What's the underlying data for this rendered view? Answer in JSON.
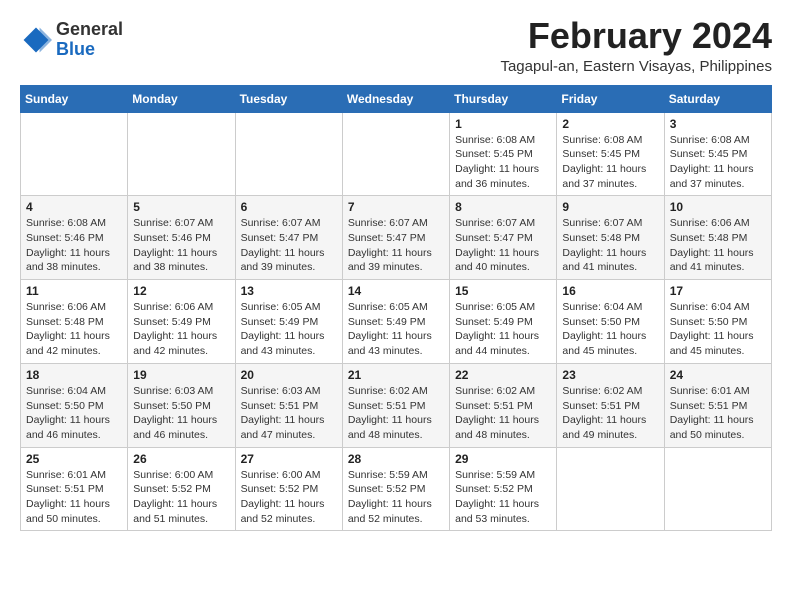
{
  "header": {
    "logo_general": "General",
    "logo_blue": "Blue",
    "month_year": "February 2024",
    "location": "Tagapul-an, Eastern Visayas, Philippines"
  },
  "weekdays": [
    "Sunday",
    "Monday",
    "Tuesday",
    "Wednesday",
    "Thursday",
    "Friday",
    "Saturday"
  ],
  "weeks": [
    [
      {
        "day": "",
        "sunrise": "",
        "sunset": "",
        "daylight": ""
      },
      {
        "day": "",
        "sunrise": "",
        "sunset": "",
        "daylight": ""
      },
      {
        "day": "",
        "sunrise": "",
        "sunset": "",
        "daylight": ""
      },
      {
        "day": "",
        "sunrise": "",
        "sunset": "",
        "daylight": ""
      },
      {
        "day": "1",
        "sunrise": "Sunrise: 6:08 AM",
        "sunset": "Sunset: 5:45 PM",
        "daylight": "Daylight: 11 hours and 36 minutes."
      },
      {
        "day": "2",
        "sunrise": "Sunrise: 6:08 AM",
        "sunset": "Sunset: 5:45 PM",
        "daylight": "Daylight: 11 hours and 37 minutes."
      },
      {
        "day": "3",
        "sunrise": "Sunrise: 6:08 AM",
        "sunset": "Sunset: 5:45 PM",
        "daylight": "Daylight: 11 hours and 37 minutes."
      }
    ],
    [
      {
        "day": "4",
        "sunrise": "Sunrise: 6:08 AM",
        "sunset": "Sunset: 5:46 PM",
        "daylight": "Daylight: 11 hours and 38 minutes."
      },
      {
        "day": "5",
        "sunrise": "Sunrise: 6:07 AM",
        "sunset": "Sunset: 5:46 PM",
        "daylight": "Daylight: 11 hours and 38 minutes."
      },
      {
        "day": "6",
        "sunrise": "Sunrise: 6:07 AM",
        "sunset": "Sunset: 5:47 PM",
        "daylight": "Daylight: 11 hours and 39 minutes."
      },
      {
        "day": "7",
        "sunrise": "Sunrise: 6:07 AM",
        "sunset": "Sunset: 5:47 PM",
        "daylight": "Daylight: 11 hours and 39 minutes."
      },
      {
        "day": "8",
        "sunrise": "Sunrise: 6:07 AM",
        "sunset": "Sunset: 5:47 PM",
        "daylight": "Daylight: 11 hours and 40 minutes."
      },
      {
        "day": "9",
        "sunrise": "Sunrise: 6:07 AM",
        "sunset": "Sunset: 5:48 PM",
        "daylight": "Daylight: 11 hours and 41 minutes."
      },
      {
        "day": "10",
        "sunrise": "Sunrise: 6:06 AM",
        "sunset": "Sunset: 5:48 PM",
        "daylight": "Daylight: 11 hours and 41 minutes."
      }
    ],
    [
      {
        "day": "11",
        "sunrise": "Sunrise: 6:06 AM",
        "sunset": "Sunset: 5:48 PM",
        "daylight": "Daylight: 11 hours and 42 minutes."
      },
      {
        "day": "12",
        "sunrise": "Sunrise: 6:06 AM",
        "sunset": "Sunset: 5:49 PM",
        "daylight": "Daylight: 11 hours and 42 minutes."
      },
      {
        "day": "13",
        "sunrise": "Sunrise: 6:05 AM",
        "sunset": "Sunset: 5:49 PM",
        "daylight": "Daylight: 11 hours and 43 minutes."
      },
      {
        "day": "14",
        "sunrise": "Sunrise: 6:05 AM",
        "sunset": "Sunset: 5:49 PM",
        "daylight": "Daylight: 11 hours and 43 minutes."
      },
      {
        "day": "15",
        "sunrise": "Sunrise: 6:05 AM",
        "sunset": "Sunset: 5:49 PM",
        "daylight": "Daylight: 11 hours and 44 minutes."
      },
      {
        "day": "16",
        "sunrise": "Sunrise: 6:04 AM",
        "sunset": "Sunset: 5:50 PM",
        "daylight": "Daylight: 11 hours and 45 minutes."
      },
      {
        "day": "17",
        "sunrise": "Sunrise: 6:04 AM",
        "sunset": "Sunset: 5:50 PM",
        "daylight": "Daylight: 11 hours and 45 minutes."
      }
    ],
    [
      {
        "day": "18",
        "sunrise": "Sunrise: 6:04 AM",
        "sunset": "Sunset: 5:50 PM",
        "daylight": "Daylight: 11 hours and 46 minutes."
      },
      {
        "day": "19",
        "sunrise": "Sunrise: 6:03 AM",
        "sunset": "Sunset: 5:50 PM",
        "daylight": "Daylight: 11 hours and 46 minutes."
      },
      {
        "day": "20",
        "sunrise": "Sunrise: 6:03 AM",
        "sunset": "Sunset: 5:51 PM",
        "daylight": "Daylight: 11 hours and 47 minutes."
      },
      {
        "day": "21",
        "sunrise": "Sunrise: 6:02 AM",
        "sunset": "Sunset: 5:51 PM",
        "daylight": "Daylight: 11 hours and 48 minutes."
      },
      {
        "day": "22",
        "sunrise": "Sunrise: 6:02 AM",
        "sunset": "Sunset: 5:51 PM",
        "daylight": "Daylight: 11 hours and 48 minutes."
      },
      {
        "day": "23",
        "sunrise": "Sunrise: 6:02 AM",
        "sunset": "Sunset: 5:51 PM",
        "daylight": "Daylight: 11 hours and 49 minutes."
      },
      {
        "day": "24",
        "sunrise": "Sunrise: 6:01 AM",
        "sunset": "Sunset: 5:51 PM",
        "daylight": "Daylight: 11 hours and 50 minutes."
      }
    ],
    [
      {
        "day": "25",
        "sunrise": "Sunrise: 6:01 AM",
        "sunset": "Sunset: 5:51 PM",
        "daylight": "Daylight: 11 hours and 50 minutes."
      },
      {
        "day": "26",
        "sunrise": "Sunrise: 6:00 AM",
        "sunset": "Sunset: 5:52 PM",
        "daylight": "Daylight: 11 hours and 51 minutes."
      },
      {
        "day": "27",
        "sunrise": "Sunrise: 6:00 AM",
        "sunset": "Sunset: 5:52 PM",
        "daylight": "Daylight: 11 hours and 52 minutes."
      },
      {
        "day": "28",
        "sunrise": "Sunrise: 5:59 AM",
        "sunset": "Sunset: 5:52 PM",
        "daylight": "Daylight: 11 hours and 52 minutes."
      },
      {
        "day": "29",
        "sunrise": "Sunrise: 5:59 AM",
        "sunset": "Sunset: 5:52 PM",
        "daylight": "Daylight: 11 hours and 53 minutes."
      },
      {
        "day": "",
        "sunrise": "",
        "sunset": "",
        "daylight": ""
      },
      {
        "day": "",
        "sunrise": "",
        "sunset": "",
        "daylight": ""
      }
    ]
  ]
}
